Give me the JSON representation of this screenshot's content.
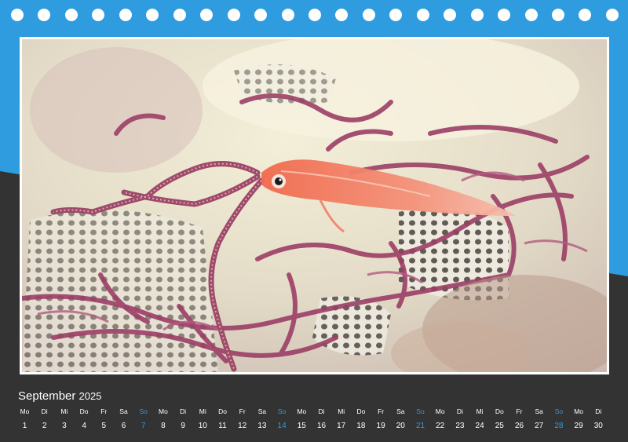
{
  "calendar": {
    "month": "September",
    "year": "2025",
    "days": [
      {
        "dow": "Mo",
        "num": "1"
      },
      {
        "dow": "Di",
        "num": "2"
      },
      {
        "dow": "Mi",
        "num": "3"
      },
      {
        "dow": "Do",
        "num": "4"
      },
      {
        "dow": "Fr",
        "num": "5"
      },
      {
        "dow": "Sa",
        "num": "6"
      },
      {
        "dow": "So",
        "num": "7"
      },
      {
        "dow": "Mo",
        "num": "8"
      },
      {
        "dow": "Di",
        "num": "9"
      },
      {
        "dow": "Mi",
        "num": "10"
      },
      {
        "dow": "Do",
        "num": "11"
      },
      {
        "dow": "Fr",
        "num": "12"
      },
      {
        "dow": "Sa",
        "num": "13"
      },
      {
        "dow": "So",
        "num": "14"
      },
      {
        "dow": "Mo",
        "num": "15"
      },
      {
        "dow": "Di",
        "num": "16"
      },
      {
        "dow": "Mi",
        "num": "17"
      },
      {
        "dow": "Do",
        "num": "18"
      },
      {
        "dow": "Fr",
        "num": "19"
      },
      {
        "dow": "Sa",
        "num": "20"
      },
      {
        "dow": "So",
        "num": "21"
      },
      {
        "dow": "Mo",
        "num": "22"
      },
      {
        "dow": "Di",
        "num": "23"
      },
      {
        "dow": "Mi",
        "num": "24"
      },
      {
        "dow": "Do",
        "num": "25"
      },
      {
        "dow": "Fr",
        "num": "26"
      },
      {
        "dow": "Sa",
        "num": "27"
      },
      {
        "dow": "So",
        "num": "28"
      },
      {
        "dow": "Mo",
        "num": "29"
      },
      {
        "dow": "Di",
        "num": "30"
      }
    ]
  },
  "colors": {
    "accent_blue": "#2f9ce0",
    "dark_band": "#333333",
    "sunday": "#3399dd",
    "text": "#ffffff"
  }
}
